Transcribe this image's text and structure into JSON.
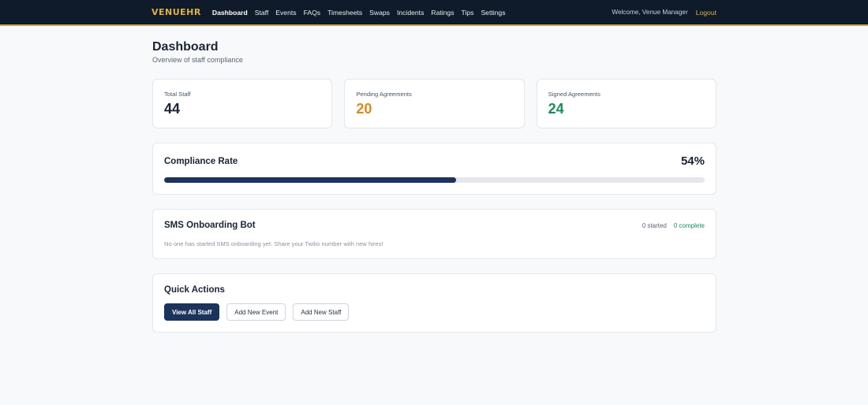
{
  "nav": {
    "brand": "VENUEHR",
    "links": [
      "Dashboard",
      "Staff",
      "Events",
      "FAQs",
      "Timesheets",
      "Swaps",
      "Incidents",
      "Ratings",
      "Tips",
      "Settings"
    ],
    "active": "Dashboard",
    "welcome": "Welcome, Venue Manager",
    "logout": "Logout"
  },
  "page": {
    "title": "Dashboard",
    "subtitle": "Overview of staff compliance"
  },
  "stats": [
    {
      "label": "Total Staff",
      "value": "44"
    },
    {
      "label": "Pending Agreements",
      "value": "20"
    },
    {
      "label": "Signed Agreements",
      "value": "24"
    }
  ],
  "compliance": {
    "title": "Compliance Rate",
    "value": "54%",
    "percent": 54
  },
  "sms": {
    "title": "SMS Onboarding Bot",
    "started": "0 started",
    "complete": "0 complete",
    "note": "No one has started SMS onboarding yet. Share your Twilio number with new hires!"
  },
  "quick_actions": {
    "title": "Quick Actions",
    "buttons": [
      "View All Staff",
      "Add New Event",
      "Add New Staff"
    ]
  },
  "colors": {
    "nav_bg": "#0f1a2b",
    "brand_gold": "#e0b04a",
    "pending": "#d88a1e",
    "signed": "#1c8a5c",
    "primary": "#1c345c"
  }
}
